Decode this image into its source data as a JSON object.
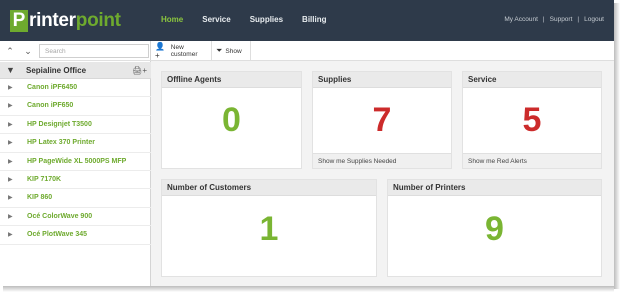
{
  "app": {
    "logo_letter": "P",
    "logo_word_1": "rinter",
    "logo_word_2": "point",
    "brand_color": "#6eaa2e"
  },
  "nav": {
    "items": [
      "Home",
      "Service",
      "Supplies",
      "Billing"
    ],
    "active": "Home"
  },
  "account": {
    "my_account": "My Account",
    "support": "Support",
    "logout": "Logout",
    "separator": "|"
  },
  "sidebar": {
    "search_placeholder": "Search",
    "office": "Sepialine Office",
    "printers": [
      "Canon iPF6450",
      "Canon iPF650",
      "HP Designjet T3500",
      "HP Latex 370 Printer",
      "HP PageWide XL 5000PS MFP",
      "KIP 7170K",
      "KIP 860",
      "Océ ColorWave 900",
      "Océ PlotWave 345"
    ]
  },
  "toolbar": {
    "new_customer": "New customer",
    "show": "Show"
  },
  "dashboard": {
    "offline_agents": {
      "title": "Offline Agents",
      "value": "0"
    },
    "supplies": {
      "title": "Supplies",
      "value": "7",
      "link": "Show me Supplies Needed"
    },
    "service": {
      "title": "Service",
      "value": "5",
      "link": "Show me Red Alerts"
    },
    "customers": {
      "title": "Number of Customers",
      "value": "1"
    },
    "printers": {
      "title": "Number of Printers",
      "value": "9"
    }
  },
  "colors": {
    "header_bg": "#2e3a4a",
    "nav_active": "#8cc63f",
    "ok_green": "#7ab533",
    "alert_red": "#cc2b2b"
  }
}
